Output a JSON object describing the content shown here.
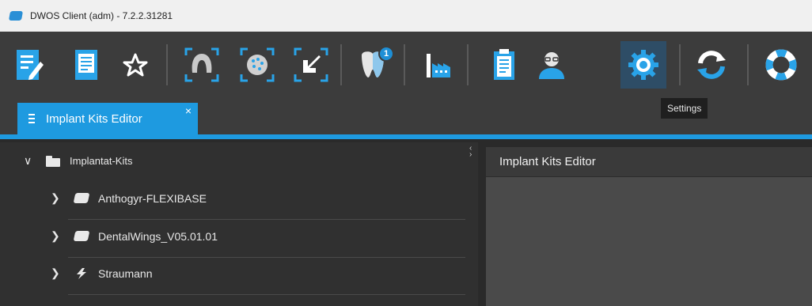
{
  "window": {
    "title": "DWOS Client (adm) - 7.2.2.31281"
  },
  "toolbar": {
    "items": [
      {
        "name": "edit-order",
        "icon": "document-edit-icon"
      },
      {
        "name": "order-list",
        "icon": "document-list-icon"
      },
      {
        "name": "favorites",
        "icon": "star-icon"
      },
      {
        "name": "scan-jaw",
        "icon": "jaw-scan-icon"
      },
      {
        "name": "scan-impression",
        "icon": "impression-scan-icon"
      },
      {
        "name": "import",
        "icon": "import-arrow-icon"
      },
      {
        "name": "design-tooth",
        "icon": "tooth-icon",
        "badge": "1"
      },
      {
        "name": "production",
        "icon": "factory-icon"
      },
      {
        "name": "reports",
        "icon": "clipboard-icon"
      },
      {
        "name": "user",
        "icon": "user-icon"
      },
      {
        "name": "settings",
        "icon": "gear-icon",
        "active": true
      },
      {
        "name": "synchronize",
        "icon": "refresh-icon"
      },
      {
        "name": "help",
        "icon": "lifebuoy-icon"
      }
    ],
    "tooltip": "Settings"
  },
  "tabs": [
    {
      "label": "Implant Kits Editor",
      "close": "×",
      "active": true
    }
  ],
  "tree": {
    "root": {
      "label": "Implantat-Kits",
      "expanded": true
    },
    "children": [
      {
        "label": "Anthogyr-FLEXIBASE",
        "icon": "implant-kit-icon"
      },
      {
        "label": "DentalWings_V05.01.01",
        "icon": "implant-kit-icon"
      },
      {
        "label": "Straumann",
        "icon": "straumann-logo-icon"
      }
    ]
  },
  "editor": {
    "title": "Implant Kits Editor"
  },
  "colors": {
    "accent": "#1e9ae0",
    "toolbar": "#3c3c3c",
    "panel": "#303030"
  }
}
